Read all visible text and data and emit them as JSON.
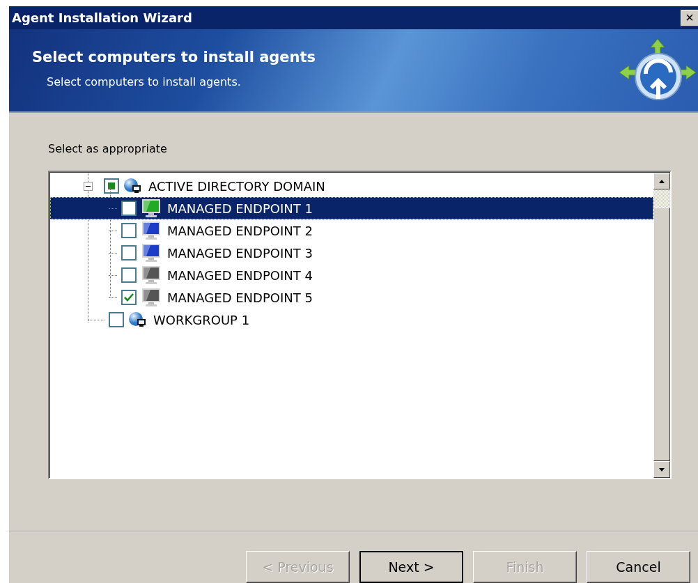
{
  "window": {
    "title": "Agent Installation Wizard",
    "close": "✕"
  },
  "header": {
    "title": "Select computers to install agents",
    "subtitle": "Select computers to install agents."
  },
  "instruction": "Select as appropriate",
  "tree": [
    {
      "label": "ACTIVE DIRECTORY DOMAIN",
      "kind": "domain",
      "checked": false,
      "partial": true,
      "expanded": true,
      "selected": false,
      "children": [
        {
          "label": "MANAGED ENDPOINT 1",
          "kind": "computer",
          "color": "#22aa22",
          "checked": false,
          "partial": false,
          "selected": true
        },
        {
          "label": "MANAGED ENDPOINT 2",
          "kind": "computer",
          "color": "#1a3cc8",
          "checked": false,
          "partial": false,
          "selected": false
        },
        {
          "label": "MANAGED ENDPOINT 3",
          "kind": "computer",
          "color": "#1a3cc8",
          "checked": false,
          "partial": false,
          "selected": false
        },
        {
          "label": "MANAGED ENDPOINT 4",
          "kind": "computer",
          "color": "#555555",
          "checked": false,
          "partial": false,
          "selected": false
        },
        {
          "label": "MANAGED ENDPOINT 5",
          "kind": "computer",
          "color": "#555555",
          "checked": true,
          "partial": false,
          "selected": false
        }
      ]
    },
    {
      "label": "WORKGROUP 1",
      "kind": "domain",
      "checked": false,
      "partial": false,
      "selected": false
    }
  ],
  "buttons": [
    {
      "label": "< Previous",
      "disabled": true,
      "default": false
    },
    {
      "label": "Next >",
      "disabled": false,
      "default": true
    },
    {
      "label": "Finish",
      "disabled": true,
      "default": false
    },
    {
      "label": "Cancel",
      "disabled": false,
      "default": false
    }
  ]
}
